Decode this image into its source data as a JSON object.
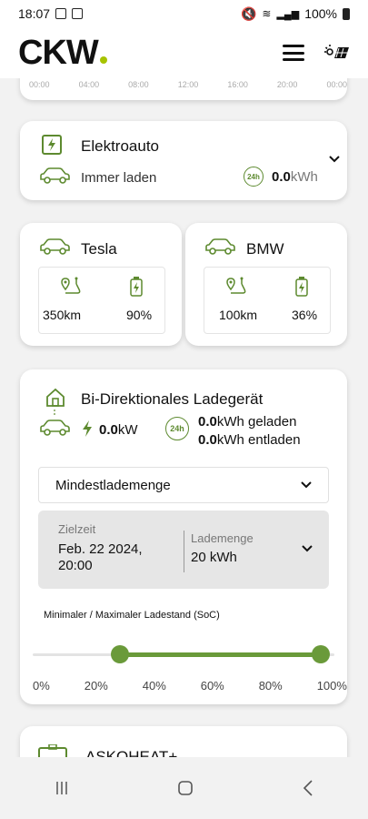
{
  "status": {
    "time": "18:07",
    "battery": "100%"
  },
  "app": {
    "logo_text": "CKW"
  },
  "timeline": {
    "ticks": [
      "00:00",
      "04:00",
      "08:00",
      "12:00",
      "16:00",
      "20:00",
      "00:00"
    ]
  },
  "elektroauto": {
    "title": "Elektroauto",
    "mode": "Immer laden",
    "kwh_value": "0.0",
    "kwh_unit": "kWh",
    "icon_24": "24h"
  },
  "cars": [
    {
      "name": "Tesla",
      "range": "350km",
      "soc": "90%"
    },
    {
      "name": "BMW",
      "range": "100km",
      "soc": "36%"
    }
  ],
  "bidir": {
    "title": "Bi-Direktionales Ladegerät",
    "power_value": "0.0",
    "power_unit": "kW",
    "charged_value": "0.0",
    "charged_text": "kWh geladen",
    "discharged_value": "0.0",
    "discharged_text": "kWh entladen",
    "icon_24": "24h",
    "mode_select": "Mindestlademenge",
    "zielzeit_label": "Zielzeit",
    "zielzeit_value_1": "Feb. 22 2024,",
    "zielzeit_value_2": "20:00",
    "lademenge_label": "Lademenge",
    "lademenge_value": "20 kWh",
    "soc_label": "Minimaler / Maximaler Ladestand (SoC)",
    "slider_ticks": [
      "0%",
      "20%",
      "40%",
      "60%",
      "80%",
      "100%"
    ],
    "slider_min": 0.29,
    "slider_max": 0.955
  },
  "askoheat": {
    "title": "ASKOHEAT+"
  },
  "colors": {
    "accent": "#5d8a2f",
    "logo_dot": "#a7c300"
  }
}
